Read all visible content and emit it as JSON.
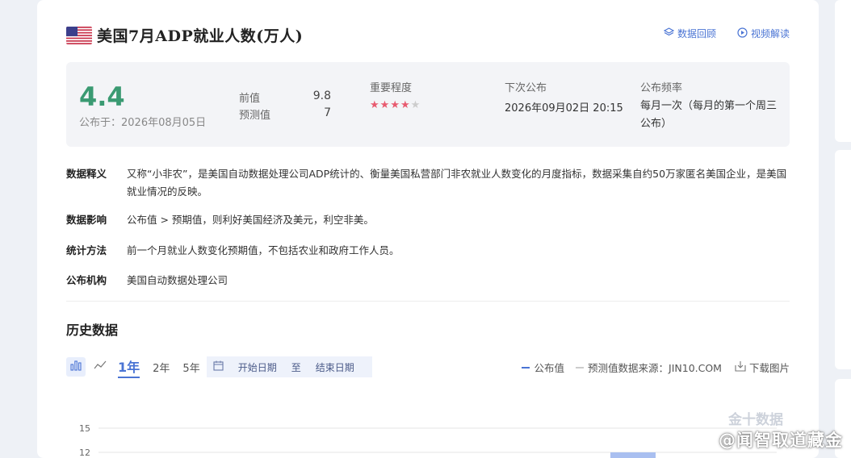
{
  "header": {
    "title": "美国7月ADP就业人数(万人)",
    "link_review": "数据回顾",
    "link_video": "视频解读"
  },
  "summary": {
    "actual": "4.4",
    "published_label": "公布于：2026年08月05日",
    "previous_label": "前值",
    "previous_value": "9.8",
    "forecast_label": "预测值",
    "forecast_value": "7",
    "importance_label": "重要程度",
    "importance_stars": 4,
    "importance_max": 5,
    "next_release_label": "下次公布",
    "next_release_value": "2026年09月02日 20:15",
    "frequency_label": "公布频率",
    "frequency_value": "每月一次（每月的第一个周三公布）"
  },
  "info": [
    {
      "key": "数据释义",
      "value": "又称“小非农”，是美国自动数据处理公司ADP统计的、衡量美国私营部门非农就业人数变化的月度指标，数据采集自约50万家匿名美国企业，是美国就业情况的反映。"
    },
    {
      "key": "数据影响",
      "value": "公布值 > 预期值，则利好美国经济及美元，利空非美。"
    },
    {
      "key": "统计方法",
      "value": "前一个月就业人数变化预期值，不包括农业和政府工作人员。"
    },
    {
      "key": "公布机构",
      "value": "美国自动数据处理公司"
    }
  ],
  "history": {
    "title": "历史数据",
    "ranges": [
      "1年",
      "2年",
      "5年"
    ],
    "active_range": "1年",
    "start_date_placeholder": "开始日期",
    "to_label": "至",
    "end_date_placeholder": "结束日期",
    "legend_actual": "公布值",
    "legend_forecast": "预测值",
    "source": "数据来源：JIN10.COM",
    "download": "下载图片"
  },
  "chart_data": {
    "type": "bar",
    "yticks": [
      "15",
      "12"
    ],
    "ylim": [
      12,
      15
    ]
  },
  "watermark": {
    "logo": "金十数据",
    "handle": "@闻智取道藏金"
  },
  "colors": {
    "actual_green": "#3a9a72",
    "accent_blue": "#4a74d4",
    "star_on": "#e85a6f",
    "star_off": "#cccccc"
  }
}
